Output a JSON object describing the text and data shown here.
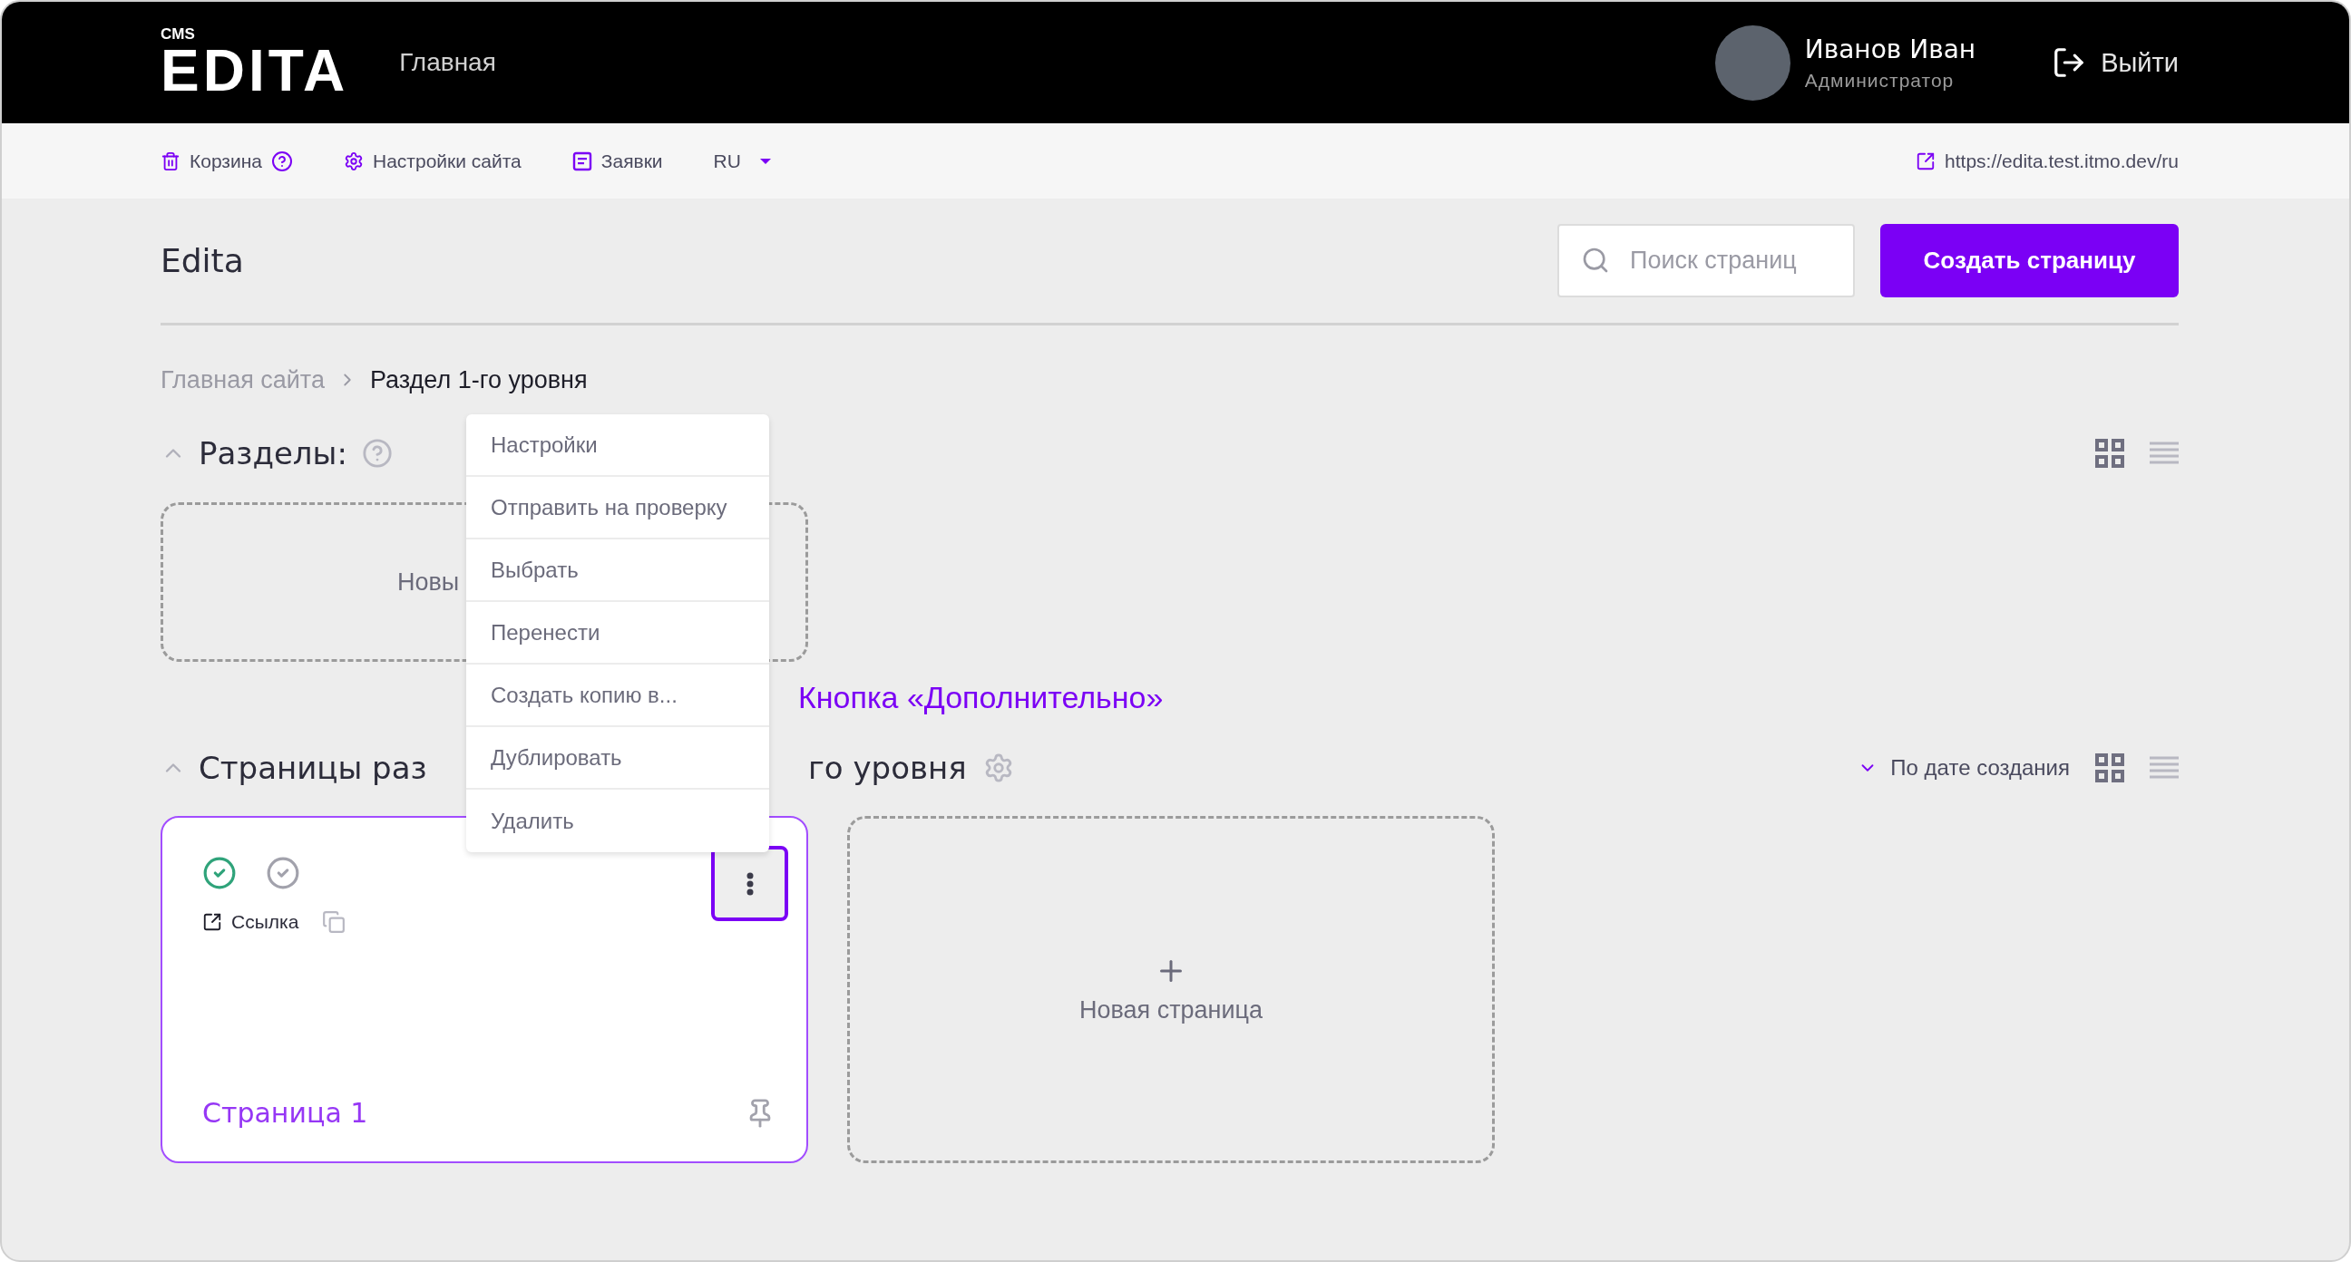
{
  "header": {
    "logo_small": "CMS",
    "logo": "EDITA",
    "nav": "Главная",
    "user": {
      "name": "Иванов Иван",
      "role": "Администратор"
    },
    "logout": "Выйти"
  },
  "toolbar": {
    "items": [
      {
        "kind": "trash",
        "label": "Корзина"
      },
      {
        "kind": "settings",
        "label": "Настройки сайта"
      },
      {
        "kind": "requests",
        "label": "Заявки"
      },
      {
        "kind": "language",
        "label": "RU"
      }
    ],
    "site_link": "https://edita.test.itmo.dev/ru"
  },
  "page": {
    "title": "Edita",
    "search": {
      "placeholder": "Поиск страниц"
    },
    "create_button": "Создать страницу"
  },
  "breadcrumbs": [
    {
      "label": "Главная сайта",
      "current": false
    },
    {
      "label": "Раздел 1-го уровня",
      "current": true
    }
  ],
  "sections_block": {
    "title": "Разделы:",
    "expanded": true,
    "view_modes": [
      {
        "selected": true
      },
      {
        "selected": false
      }
    ],
    "new_card": "Новы"
  },
  "pages_block": {
    "title_parts": [
      "Страницы раз",
      "го уровня"
    ],
    "expanded": true,
    "sort": "По дате создания",
    "view_modes": [
      {
        "selected": true
      },
      {
        "selected": false
      }
    ],
    "pages": [
      {
        "title": "Страница 1",
        "statuses": [
          {
            "active": true
          },
          {
            "active": false
          }
        ],
        "link": "Ссылка",
        "menu_open": true
      }
    ],
    "new_card": "Новая страница"
  },
  "context_menu": {
    "items": [
      "Настройки",
      "Отправить на проверку",
      "Выбрать",
      "Перенести",
      "Создать копию в...",
      "Дублировать",
      "Удалить"
    ]
  },
  "annotation": "Кнопка «Дополнительно»"
}
